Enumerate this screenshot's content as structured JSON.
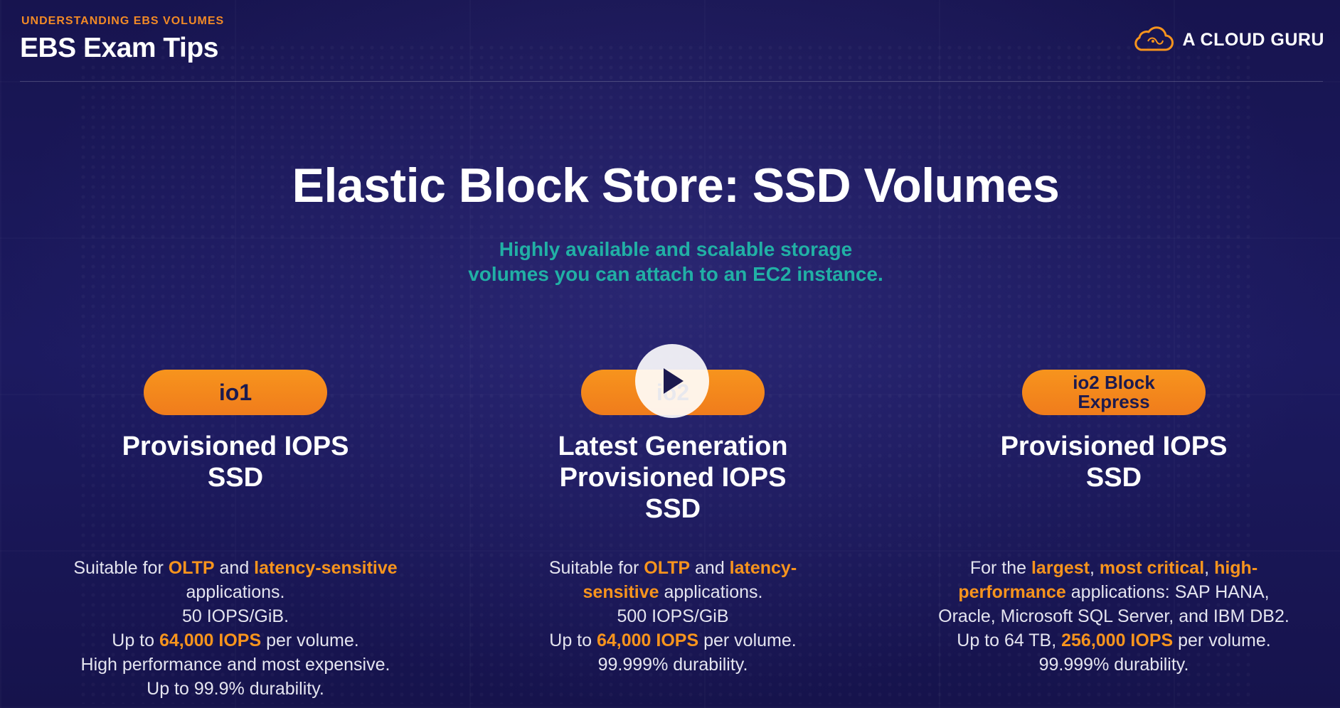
{
  "header": {
    "section_label": "UNDERSTANDING EBS VOLUMES",
    "page_heading": "EBS Exam Tips",
    "brand_name": "A CLOUD GURU"
  },
  "slide": {
    "title": "Elastic Block Store: SSD Volumes",
    "subtitle_line1": "Highly available and scalable storage",
    "subtitle_line2": "volumes you can attach to an EC2 instance."
  },
  "columns": [
    {
      "badge": "io1",
      "title_line1": "Provisioned IOPS",
      "title_line2": "SSD",
      "desc": {
        "l1_a": "Suitable for ",
        "l1_b": "OLTP",
        "l1_c": " and ",
        "l1_d": "latency-sensitive",
        "l2": "applications.",
        "l3": "50 IOPS/GiB.",
        "l4_a": "Up to ",
        "l4_b": "64,000 IOPS",
        "l4_c": " per volume.",
        "l5": "High performance and most expensive.",
        "l6": "Up to 99.9% durability."
      }
    },
    {
      "badge": "io2",
      "title_line1": "Latest Generation",
      "title_line2": "Provisioned IOPS",
      "title_line3": "SSD",
      "desc": {
        "l1_a": "Suitable for ",
        "l1_b": "OLTP",
        "l1_c": " and ",
        "l1_d": "latency-",
        "l2_a": "sensitive",
        "l2_b": " applications.",
        "l3": "500 IOPS/GiB",
        "l4_a": "Up to ",
        "l4_b": "64,000 IOPS",
        "l4_c": " per volume.",
        "l5": "99.999% durability."
      }
    },
    {
      "badge_line1": "io2 Block",
      "badge_line2": "Express",
      "title_line1": "Provisioned IOPS",
      "title_line2": "SSD",
      "desc": {
        "l1_a": "For the ",
        "l1_b": "largest",
        "l1_c": ", ",
        "l1_d": "most critical",
        "l1_e": ", ",
        "l1_f": "high-",
        "l2_a": "performance",
        "l2_b": " applications: SAP HANA,",
        "l3": "Oracle, Microsoft SQL Server, and IBM DB2.",
        "l4_a": "Up to 64 TB, ",
        "l4_b": "256,000 IOPS",
        "l4_c": " per volume.",
        "l5": "99.999% durability."
      }
    }
  ],
  "icons": {
    "brand_logo": "cloud-icon",
    "play": "play-icon"
  },
  "colors": {
    "accent_orange": "#f7941d",
    "accent_teal": "#21b0a5",
    "background": "#1a1757"
  }
}
